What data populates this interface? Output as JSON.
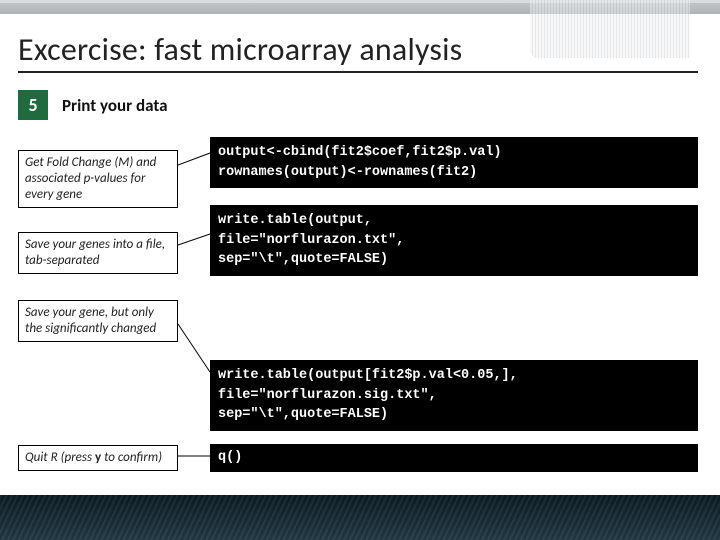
{
  "title": "Excercise: fast microarray analysis",
  "step": {
    "number": "5",
    "label": "Print your data"
  },
  "notes": {
    "n1": "Get Fold Change (M) and associated p-values for every gene",
    "n2": "Save your genes into a file, tab-separated",
    "n3": "Save your gene, but only the significantly changed",
    "n4_pre": "Quit R (press ",
    "n4_key": "y",
    "n4_post": " to confirm)"
  },
  "code": {
    "c1": "output<-cbind(fit2$coef,fit2$p.val)\nrownames(output)<-rownames(fit2)",
    "c2": "write.table(output,\nfile=\"norflurazon.txt\",\nsep=\"\\t\",quote=FALSE)",
    "c3": "write.table(output[fit2$p.val<0.05,],\nfile=\"norflurazon.sig.txt\",\nsep=\"\\t\",quote=FALSE)",
    "c4": "q()"
  }
}
